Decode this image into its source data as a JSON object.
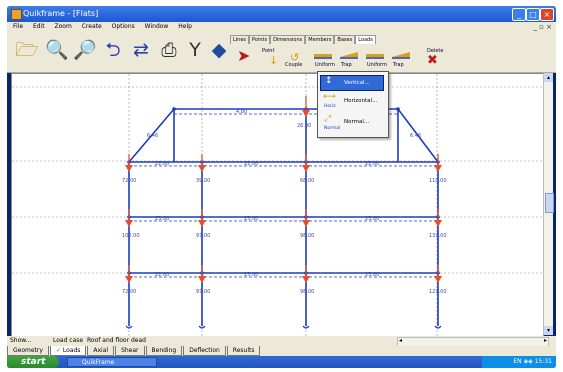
{
  "window": {
    "title": "Quikframe - [Flats]",
    "controls": [
      "_",
      "□",
      "×"
    ]
  },
  "menu": {
    "items": [
      "File",
      "Edit",
      "Zoom",
      "Create",
      "Options",
      "Window",
      "Help"
    ],
    "mdi_controls": "_ ▫ ×"
  },
  "toolbar": {
    "icons": [
      "open-folder-icon",
      "zoom-in-icon",
      "zoom-out-icon",
      "undo-icon",
      "redo-icon",
      "print-icon",
      "wrench-icon",
      "book-icon"
    ],
    "tabs": [
      "Lines",
      "Points",
      "Dimensions",
      "Members",
      "Bases",
      "Loads"
    ],
    "active_tab": "Loads",
    "load_tools": {
      "point": "Point",
      "couple": "Couple",
      "uniform1": "Uniform",
      "trap1": "Trap",
      "uniform2": "Uniform",
      "trap2": "Trap",
      "delete": "Delete"
    }
  },
  "direction_menu": {
    "options": [
      "Vertical...",
      "Horizontal...",
      "Normal..."
    ],
    "small_labels": [
      "Horiz",
      "Normal"
    ],
    "highlighted": "Vertical..."
  },
  "frame": {
    "dims": [
      "4.80",
      "6.46",
      "6.46",
      "22.00",
      "22.00",
      "22.00",
      "23.00",
      "23.00",
      "23.00",
      "22.00",
      "23.00",
      "23.00"
    ],
    "point_loads": [
      "72.00",
      "39.00",
      "68.00",
      "110.00",
      "102.00",
      "97.00",
      "98.00",
      "131.00",
      "72.00",
      "97.00",
      "98.00",
      "121.00",
      "26.00"
    ]
  },
  "status": {
    "text": "Show...",
    "load_case_label": "Load case",
    "load_case_value": "Roof and floor dead"
  },
  "bottom_tabs": [
    "Geometry",
    "Loads",
    "Axial",
    "Shear",
    "Bending",
    "Deflection",
    "Results"
  ],
  "active_bottom_tab": "Loads",
  "taskbar": {
    "start": "start",
    "task": "QuikFrame",
    "lang": "EN",
    "time": "15:31"
  },
  "colors": {
    "frame_line": "#1c3bbd",
    "load_arrow": "#e2502a",
    "dim_text": "#3a4aa8"
  }
}
